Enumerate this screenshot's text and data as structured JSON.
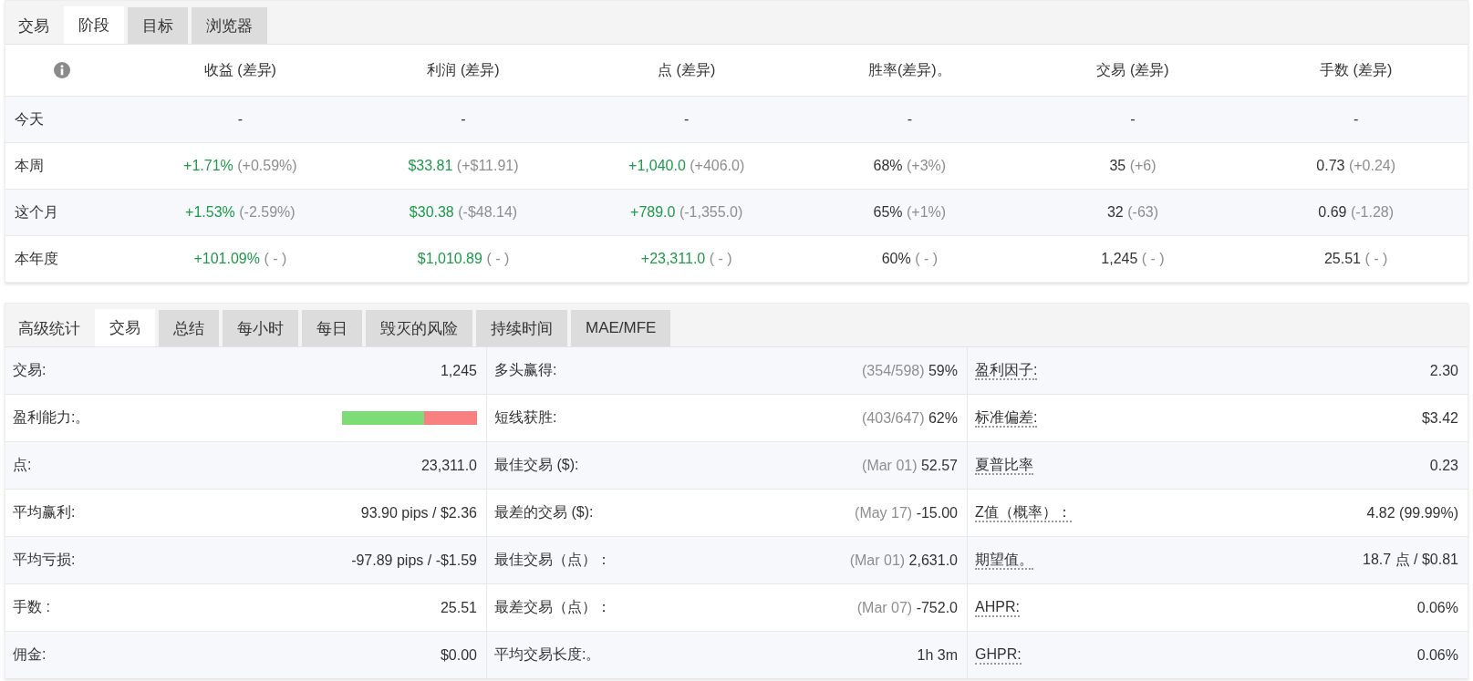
{
  "period_panel": {
    "tabs": [
      {
        "label": "交易",
        "kind": "heading",
        "selected": false
      },
      {
        "label": "阶段",
        "kind": "tab",
        "selected": true
      },
      {
        "label": "目标",
        "kind": "tab",
        "selected": false
      },
      {
        "label": "浏览器",
        "kind": "tab",
        "selected": false
      }
    ],
    "table": {
      "columns": [
        "收益 (差异)",
        "利润 (差异)",
        "点 (差异)",
        "胜率(差异)。",
        "交易 (差异)",
        "手数 (差异)"
      ],
      "rows": [
        {
          "label": "今天",
          "cells": [
            {
              "value": "-",
              "kind": "plain"
            },
            {
              "value": "-",
              "kind": "plain"
            },
            {
              "value": "-",
              "kind": "plain"
            },
            {
              "value": "-",
              "kind": "plain"
            },
            {
              "value": "-",
              "kind": "plain"
            },
            {
              "value": "-",
              "kind": "plain"
            }
          ]
        },
        {
          "label": "本周",
          "cells": [
            {
              "value": "+1.71%",
              "diff": "(+0.59%)",
              "kind": "gain"
            },
            {
              "value": "$33.81",
              "diff": "(+$11.91)",
              "kind": "gain"
            },
            {
              "value": "+1,040.0",
              "diff": "(+406.0)",
              "kind": "gain"
            },
            {
              "value": "68%",
              "diff": "(+3%)",
              "kind": "plain"
            },
            {
              "value": "35",
              "diff": "(+6)",
              "kind": "plain"
            },
            {
              "value": "0.73",
              "diff": "(+0.24)",
              "kind": "plain"
            }
          ]
        },
        {
          "label": "这个月",
          "cells": [
            {
              "value": "+1.53%",
              "diff": "(-2.59%)",
              "kind": "gain"
            },
            {
              "value": "$30.38",
              "diff": "(-$48.14)",
              "kind": "gain"
            },
            {
              "value": "+789.0",
              "diff": "(-1,355.0)",
              "kind": "gain"
            },
            {
              "value": "65%",
              "diff": "(+1%)",
              "kind": "plain"
            },
            {
              "value": "32",
              "diff": "(-63)",
              "kind": "plain"
            },
            {
              "value": "0.69",
              "diff": "(-1.28)",
              "kind": "plain"
            }
          ]
        },
        {
          "label": "本年度",
          "cells": [
            {
              "value": "+101.09%",
              "diff": "( - )",
              "kind": "gain"
            },
            {
              "value": "$1,010.89",
              "diff": "( - )",
              "kind": "gain"
            },
            {
              "value": "+23,311.0",
              "diff": "( - )",
              "kind": "gain"
            },
            {
              "value": "60%",
              "diff": "( - )",
              "kind": "plain"
            },
            {
              "value": "1,245",
              "diff": "( - )",
              "kind": "plain"
            },
            {
              "value": "25.51",
              "diff": "( - )",
              "kind": "plain"
            }
          ]
        }
      ]
    }
  },
  "stats_panel": {
    "tabs": [
      {
        "label": "高级统计",
        "kind": "heading",
        "selected": false
      },
      {
        "label": "交易",
        "kind": "tab",
        "selected": true
      },
      {
        "label": "总结",
        "kind": "tab",
        "selected": false
      },
      {
        "label": "每小时",
        "kind": "tab",
        "selected": false
      },
      {
        "label": "每日",
        "kind": "tab",
        "selected": false
      },
      {
        "label": "毁灭的风险",
        "kind": "tab",
        "selected": false
      },
      {
        "label": "持续时间",
        "kind": "tab",
        "selected": false
      },
      {
        "label": "MAE/MFE",
        "kind": "tab",
        "selected": false
      }
    ],
    "rows": [
      [
        {
          "label": "交易:",
          "value": "1,245",
          "kind": "plain"
        },
        {
          "label": "多头赢得:",
          "detail": "(354/598)",
          "value": "59%",
          "kind": "plain"
        },
        {
          "label": "盈利因子:",
          "value": "2.30",
          "kind": "term"
        }
      ],
      [
        {
          "label": "盈利能力:。",
          "level": 0.61,
          "kind": "bar"
        },
        {
          "label": "短线获胜:",
          "detail": "(403/647)",
          "value": "62%",
          "kind": "plain"
        },
        {
          "label": "标准偏差:",
          "value": "$3.42",
          "kind": "term"
        }
      ],
      [
        {
          "label": "点:",
          "value": "23,311.0",
          "kind": "plain"
        },
        {
          "label": "最佳交易 ($):",
          "detail": "(Mar 01)",
          "value": "52.57",
          "kind": "plain"
        },
        {
          "label": "夏普比率",
          "value": "0.23",
          "kind": "term"
        }
      ],
      [
        {
          "label": "平均赢利:",
          "value": "93.90 pips / $2.36",
          "kind": "plain"
        },
        {
          "label": "最差的交易 ($):",
          "detail": "(May 17)",
          "value": "-15.00",
          "kind": "plain"
        },
        {
          "label": "Z值（概率）：",
          "value": "4.82 (99.99%)",
          "kind": "term"
        }
      ],
      [
        {
          "label": "平均亏损:",
          "value": "-97.89 pips / -$1.59",
          "kind": "plain"
        },
        {
          "label": "最佳交易（点）：",
          "detail": "(Mar 01)",
          "value": "2,631.0",
          "kind": "plain"
        },
        {
          "label": "期望值。",
          "value": "18.7 点 / $0.81",
          "kind": "term"
        }
      ],
      [
        {
          "label": "手数 :",
          "value": "25.51",
          "kind": "plain"
        },
        {
          "label": "最差交易（点）：",
          "detail": "(Mar 07)",
          "value": "-752.0",
          "kind": "plain"
        },
        {
          "label": "AHPR:",
          "value": "0.06%",
          "kind": "term"
        }
      ],
      [
        {
          "label": "佣金:",
          "value": "$0.00",
          "kind": "plain"
        },
        {
          "label": "平均交易长度:。",
          "value": "1h 3m",
          "kind": "plain"
        },
        {
          "label": "GHPR:",
          "value": "0.06%",
          "kind": "term"
        }
      ]
    ]
  }
}
